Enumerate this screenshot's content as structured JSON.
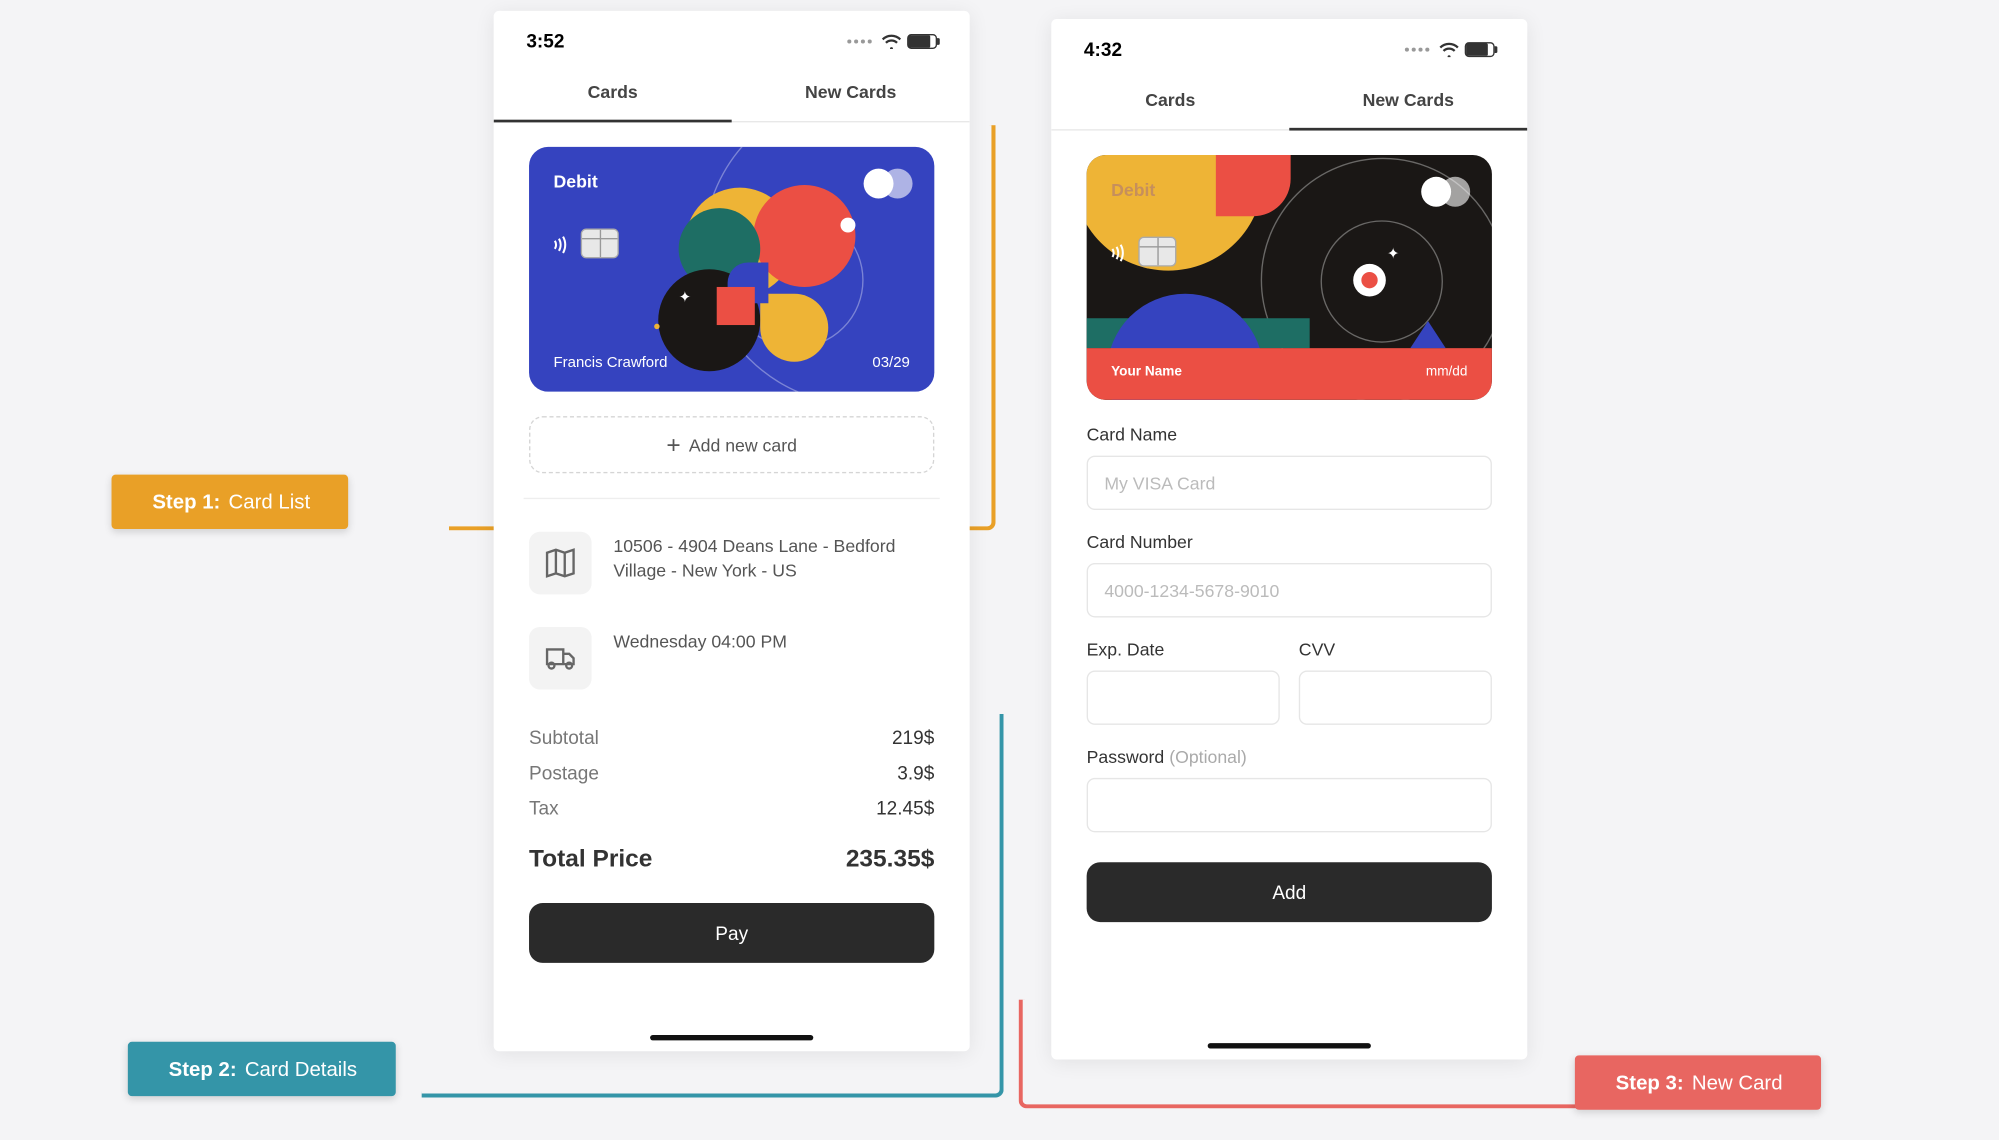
{
  "phone1": {
    "time": "3:52",
    "tabs": {
      "cards": "Cards",
      "new": "New Cards"
    },
    "card": {
      "label": "Debit",
      "name": "Francis Crawford",
      "exp": "03/29"
    },
    "addCardLabel": "Add new card",
    "address": "10506 - 4904 Deans Lane - Bedford Village - New York - US",
    "delivery": "Wednesday 04:00 PM",
    "prices": {
      "subtotalLabel": "Subtotal",
      "subtotalVal": "219$",
      "postageLabel": "Postage",
      "postageVal": "3.9$",
      "taxLabel": "Tax",
      "taxVal": "12.45$",
      "totalLabel": "Total Price",
      "totalVal": "235.35$"
    },
    "payLabel": "Pay"
  },
  "phone2": {
    "time": "4:32",
    "tabs": {
      "cards": "Cards",
      "new": "New Cards"
    },
    "card": {
      "label": "Debit",
      "name": "Your Name",
      "exp": "mm/dd"
    },
    "form": {
      "cardNameLabel": "Card Name",
      "cardNamePh": "My VISA Card",
      "cardNumberLabel": "Card Number",
      "cardNumberPh": "4000-1234-5678-9010",
      "expLabel": "Exp. Date",
      "cvvLabel": "CVV",
      "passwordLabel": "Password",
      "passwordOpt": "(Optional)"
    },
    "addLabel": "Add"
  },
  "steps": {
    "s1bold": "Step 1:",
    "s1text": "Card List",
    "s2bold": "Step 2:",
    "s2text": "Card Details",
    "s3bold": "Step 3:",
    "s3text": "New Card"
  }
}
